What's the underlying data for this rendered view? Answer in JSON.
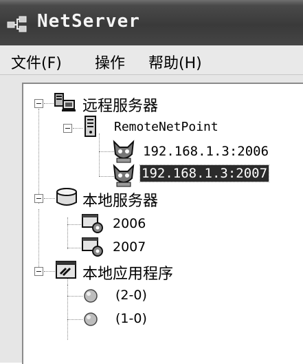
{
  "window": {
    "title": "NetServer"
  },
  "menu": {
    "items": [
      "文件(F)",
      "操作",
      "帮助(H)"
    ]
  },
  "tree": {
    "remote_servers": "远程服务器",
    "remote_net_point": "RemoteNetPoint",
    "remote_ip_1": "192.168.1.3:2006",
    "remote_ip_2": "192.168.1.3:2007",
    "local_servers": "本地服务器",
    "local_port_1": "2006",
    "local_port_2": "2007",
    "local_apps": "本地应用程序",
    "app_1": "(2-0)",
    "app_2": "(1-0)"
  }
}
